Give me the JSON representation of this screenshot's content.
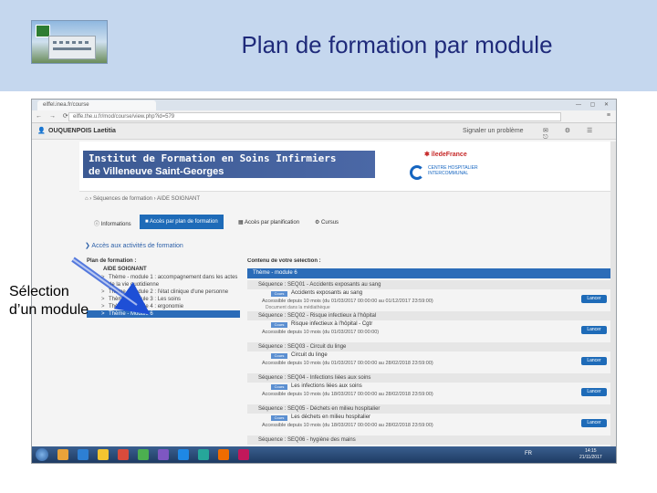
{
  "slide": {
    "title": "Plan de formation par module",
    "callout": [
      "Sélection",
      "d’un module"
    ]
  },
  "browser": {
    "tab_title": "eiffel.inea.fr/course",
    "url": "eiffe.the.u.fr/mod/course/view.php?id=579",
    "window_controls": "— ▢ ✕",
    "nav_icons": "← → ⟳",
    "menu_icon": "≡"
  },
  "userbar": {
    "name": "OUQUENPOIS Laetitia",
    "report_label": "Signaler un problème",
    "tools": "✉ ⚙ ☰ ⎋"
  },
  "banner": {
    "line1": "Institut de Formation en Soins Infirmiers",
    "line2": "de Villeneuve Saint-Georges",
    "region_logo": "✱ îledeFrance",
    "hospital_logo": "CENTRE HOSPITALIER INTERCOMMUNAL"
  },
  "breadcrumb": "⌂  ›  Séquences de formation  ›  AIDE SOIGNANT",
  "tabs": [
    {
      "label": "ⓘ Informations"
    },
    {
      "label": "■ Accès par plan de formation"
    },
    {
      "label": "▦ Accès par planification"
    },
    {
      "label": "⚙ Cursus"
    }
  ],
  "access_link": "❯  Accès aux activités de formation",
  "left_panel": {
    "heading": "Plan de formation :",
    "root": "AIDE SOIGNANT",
    "modules": [
      {
        "label": "Thème - module 1 : accompagnement dans les actes de la vie quotidienne",
        "selected": false
      },
      {
        "label": "Thème - Module 2 : l'état clinique d'une personne",
        "selected": false
      },
      {
        "label": "Thème - module 3 : Les soins",
        "selected": false
      },
      {
        "label": "Thème - module 4 : ergonomie",
        "selected": false
      },
      {
        "label": "Thème - Module 6",
        "selected": true
      }
    ]
  },
  "right_panel": {
    "heading": "Contenu de votre sélection :",
    "theme": "Thème - module 6",
    "sequences": [
      {
        "title": "Séquence : SEQ01 - Accidents exposants au sang",
        "resource": "Accidents exposants au sang",
        "dates": "Accessible depuis 10 mois (du 01/03/2017 00:00:00 au 01/12/2017 23:59:00)",
        "doc": "Document dans la médiathèque",
        "tag": "Cours",
        "launch": "Lancer"
      },
      {
        "title": "Séquence : SEQ02 - Risque infectieux à l'hôpital",
        "resource": "Risque infectieux à l'hôpital - Cgtr",
        "dates": "Accessible depuis 10 mois (du 01/03/2017 00:00:00)",
        "doc": "",
        "tag": "Cours",
        "launch": "Lancer"
      },
      {
        "title": "Séquence : SEQ03 - Circuit du linge",
        "resource": "Circuit du linge",
        "dates": "Accessible depuis 10 mois (du 01/03/2017 00:00:00 au 28/02/2018 23:59:00)",
        "doc": "",
        "tag": "Cours",
        "launch": "Lancer"
      },
      {
        "title": "Séquence : SEQ04 - Infections liées aux soins",
        "resource": "Les infections liées aux soins",
        "dates": "Accessible depuis 10 mois (du 18/03/2017 00:00:00 au 28/02/2018 23:59:00)",
        "doc": "",
        "tag": "Cours",
        "launch": "Lancer"
      },
      {
        "title": "Séquence : SEQ05 - Déchets en milieu hospitalier",
        "resource": "Les déchets en milieu hospitalier",
        "dates": "Accessible depuis 10 mois (du 18/03/2017 00:00:00 au 28/02/2018 23:59:00)",
        "doc": "",
        "tag": "Cours",
        "launch": "Lancer"
      }
    ],
    "last_sequence": "Séquence : SEQ06 - hygiène des mains"
  },
  "taskbar": {
    "lang": "FR",
    "time": "14:15",
    "date": "21/11/2017",
    "icon_colors": [
      "#e8a23a",
      "#2d7fd3",
      "#f4c430",
      "#d94b3c",
      "#4caf50",
      "#7e57c2",
      "#1e88e5",
      "#26a69a",
      "#ef6c00",
      "#c2185b"
    ]
  },
  "colors": {
    "header_band": "#c5d7ee",
    "title": "#1f2a7a",
    "accent": "#1e6bb8",
    "arrow": "#1e4fd6"
  }
}
